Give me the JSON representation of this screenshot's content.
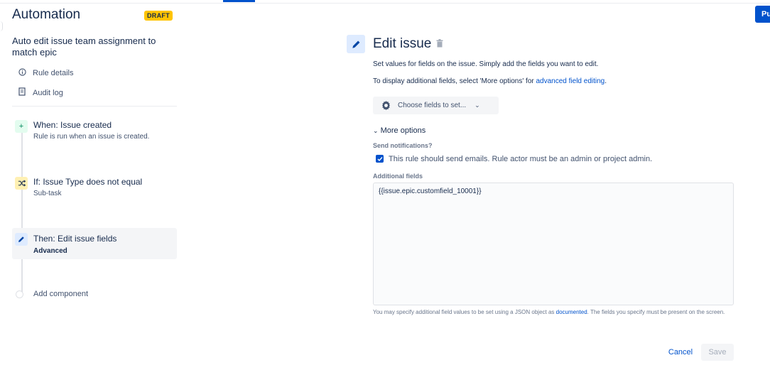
{
  "header": {
    "title": "Automation",
    "status_badge": "DRAFT",
    "publish_button_label": "Pu"
  },
  "sidebar": {
    "rule_name": "Auto edit issue team assignment to match epic",
    "links": [
      {
        "label": "Rule details",
        "icon": "info-icon"
      },
      {
        "label": "Audit log",
        "icon": "document-icon"
      }
    ],
    "steps": [
      {
        "title": "When: Issue created",
        "subtitle": "Rule is run when an issue is created.",
        "icon": "plus-icon",
        "color": "#e3fcef"
      },
      {
        "title": "If: Issue Type does not equal",
        "subtitle": "Sub-task",
        "icon": "shuffle-icon",
        "color": "#fff0b3"
      },
      {
        "title": "Then: Edit issue fields",
        "subtitle": "Advanced",
        "icon": "pencil-icon",
        "color": "#deebff"
      }
    ],
    "add_component_label": "Add component"
  },
  "panel": {
    "title": "Edit issue",
    "description": "Set values for fields on the issue. Simply add the fields you want to edit.",
    "info_prefix": "To display additional fields, select 'More options' for ",
    "info_link": "advanced field editing",
    "info_suffix": ".",
    "choose_fields_label": "Choose fields to set...",
    "more_options_label": "More options",
    "send_notifications_label": "Send notifications?",
    "send_notifications_checkbox": "This rule should send emails. Rule actor must be an admin or project admin.",
    "send_notifications_checked": true,
    "additional_fields_label": "Additional fields",
    "additional_fields_value": "{{issue.epic.customfield_10001}}",
    "help_prefix": "You may specify additional field values to be set using a JSON object as ",
    "help_link": "documented",
    "help_suffix": ". The fields you specify must be present on the screen.",
    "cancel_label": "Cancel",
    "save_label": "Save"
  },
  "colors": {
    "accent": "#0052cc",
    "badge": "#ffc400"
  }
}
